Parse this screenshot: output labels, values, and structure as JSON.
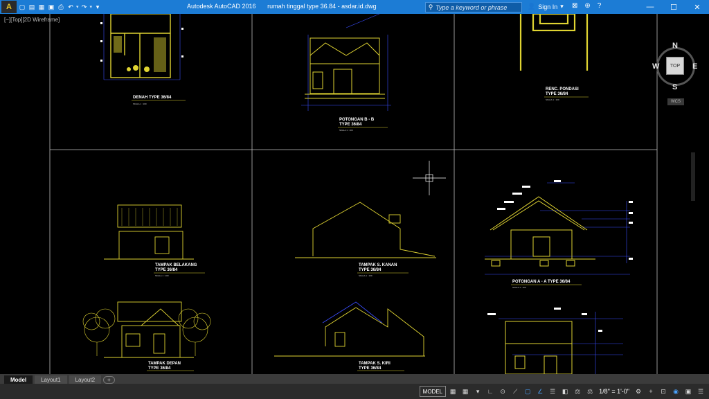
{
  "titlebar": {
    "app_button": "A",
    "qat": {
      "new": "▢",
      "open": "▤",
      "save": "▦",
      "saveas": "▣",
      "print": "⎙",
      "undo": "↶",
      "redo": "↷",
      "more": "▾"
    },
    "app_title": "Autodesk AutoCAD 2016",
    "file_title": "rumah tinggal type 36.84 - asdar.id.dwg",
    "search_placeholder": "Type a keyword or phrase",
    "search_icon": "⚲",
    "signin_icon": "👤",
    "signin_label": "Sign In",
    "right_icons": {
      "cart": "⊠",
      "exchange": "⊛",
      "arrow": "▾",
      "help": "?"
    },
    "minimize": "—",
    "maximize": "☐",
    "close": "✕"
  },
  "viewport": {
    "label": "[−][Top][2D Wireframe]",
    "drawings": {
      "denah": {
        "title": "DENAH TYPE 36/84",
        "scale": "SKALA  1 : 100"
      },
      "potongan_b": {
        "title_1": "POTONGAN B - B",
        "title_2": "TYPE 36/84",
        "scale": "SKALA  1 : 100"
      },
      "pondasi": {
        "title_1": "RENC. PONDASI",
        "title_2": "TYPE 36/84",
        "scale": "SKALA  1 : 100"
      },
      "belakang": {
        "title_1": "TAMPAK BELAKANG",
        "title_2": "TYPE 36/84",
        "scale": "SKALA  1 : 100"
      },
      "kanan": {
        "title_1": "TAMPAK S. KANAN",
        "title_2": "TYPE 36/84",
        "scale": "SKALA  1 : 100"
      },
      "potongan_a": {
        "title": "POTONGAN A - A  TYPE 36/84",
        "scale": "SKALA  1 : 100"
      },
      "depan": {
        "title_1": "TAMPAK DEPAN",
        "title_2": "TYPE 36/84",
        "scale": "SKALA  1 : 100"
      },
      "kiri": {
        "title_1": "TAMPAK S. KIRI",
        "title_2": "TYPE 36/84",
        "scale": "SKALA  1 : 100"
      }
    }
  },
  "viewcube": {
    "n": "N",
    "s": "S",
    "e": "E",
    "w": "W",
    "face": "TOP",
    "wcs": "WCS"
  },
  "tabs": {
    "model": "Model",
    "layout1": "Layout1",
    "layout2": "Layout2",
    "add": "+"
  },
  "statusbar": {
    "model": "MODEL",
    "grid": "▦",
    "snap": "▦",
    "infer": "▾",
    "ortho": "∟",
    "polar": "⊙",
    "isodraft": "⟋",
    "osnap": "▢",
    "otrack": "∠",
    "lineweight": "☰",
    "transparency": "◧",
    "annotation_visibility": "⚖",
    "annotation_autoscale": "⚖",
    "scale": "1/8\" = 1'-0\"",
    "gear": "⚙",
    "plus": "+",
    "isolate": "⊡",
    "hardware": "◉",
    "clean_screen": "▣",
    "customize": "☰"
  },
  "colors": {
    "titlebar": "#1c7cd5",
    "drawing_yellow": "#e0d432",
    "drawing_blue": "#3a4dff",
    "grid_line": "#bfbfbf"
  }
}
